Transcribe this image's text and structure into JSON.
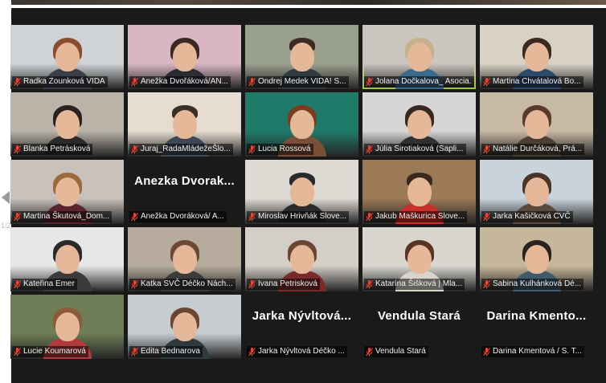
{
  "meeting": {
    "page_indicator": "1/2",
    "active_border_color": "#b7e34d",
    "muted_icon": "mic-muted-icon",
    "muted_color": "#e0483a"
  },
  "participants": [
    {
      "name": "Radka Zounková VIDA",
      "muted": true,
      "video": true,
      "bg": "#cfd3d6",
      "torso": "#3b3d48",
      "hair": "#8a4c2e",
      "type": "woman"
    },
    {
      "name": "Anežka Dvořáková/AN...",
      "muted": true,
      "video": true,
      "bg": "#d9b6c4",
      "torso": "#2c2c33",
      "hair": "#3a2a22",
      "type": "woman"
    },
    {
      "name": "Ondrej Medek VIDA! S...",
      "muted": true,
      "video": true,
      "bg": "#9aa08e",
      "torso": "#2f3b40",
      "hair": "#3b2b20",
      "type": "man"
    },
    {
      "name": "Jolana Dočkalova_ Asocia...",
      "muted": true,
      "video": true,
      "active": true,
      "bg": "#cbc6bf",
      "torso": "#3a6b8a",
      "hair": "#c4b18d",
      "type": "woman"
    },
    {
      "name": "Martina Chvátalová Bo...",
      "muted": true,
      "video": true,
      "bg": "#d8d2c5",
      "torso": "#2b4a6b",
      "hair": "#3a2a22",
      "type": "woman"
    },
    {
      "name": "Blanka Petrásková",
      "muted": true,
      "video": true,
      "bg": "#b9b3a8",
      "torso": "#2a2a2a",
      "hair": "#2b2220",
      "type": "woman"
    },
    {
      "name": "Juraj_RadaMládežeŠlo...",
      "muted": true,
      "video": true,
      "bg": "#e6ddd0",
      "torso": "#3f4655",
      "hair": "#3a2e25",
      "type": "man"
    },
    {
      "name": "Lucia Rossová",
      "muted": true,
      "video": true,
      "bg": "#1f7a6a",
      "torso": "#7a4f37",
      "hair": "#7a3c22",
      "type": "woman"
    },
    {
      "name": "Júlia Sirotiaková (Sapli...",
      "muted": true,
      "video": true,
      "bg": "#d6d6d6",
      "torso": "#303030",
      "hair": "#3a2820",
      "type": "woman"
    },
    {
      "name": "Natálie Durčáková, Prá...",
      "muted": true,
      "video": true,
      "bg": "#c8b9a4",
      "torso": "#4a3f35",
      "hair": "#5a3a2a",
      "type": "woman"
    },
    {
      "name": "Martina Škutová_Dom...",
      "muted": true,
      "video": true,
      "bg": "#c9c1bb",
      "torso": "#5a2430",
      "hair": "#9a6a3c",
      "type": "woman"
    },
    {
      "name": "Anežka Dvoráková/ A...",
      "muted": true,
      "video": false,
      "display": "Anezka Dvorak..."
    },
    {
      "name": "Miroslav Hrivňák Slove...",
      "muted": true,
      "video": true,
      "bg": "#dedad4",
      "torso": "#2b2b2b",
      "hair": "#2a2a2a",
      "type": "man"
    },
    {
      "name": "Jakub Maškurica Slove...",
      "muted": true,
      "video": true,
      "bg": "#9c7a58",
      "torso": "#c8302c",
      "hair": "#3a2a1e",
      "type": "man"
    },
    {
      "name": "Jarka Kašičková CVČ",
      "muted": true,
      "video": true,
      "bg": "#c9d3dc",
      "torso": "#5a4a3c",
      "hair": "#4a3428",
      "type": "woman"
    },
    {
      "name": "Kateřina Emer",
      "muted": true,
      "video": true,
      "bg": "#e7e7e7",
      "torso": "#3a3a3a",
      "hair": "#2a2a2a",
      "type": "woman"
    },
    {
      "name": "Katka SVČ Déčko Nách...",
      "muted": true,
      "video": true,
      "bg": "#b6ab9c",
      "torso": "#3b3b3b",
      "hair": "#6a4a35",
      "type": "woman"
    },
    {
      "name": "Ivana Petrisková",
      "muted": true,
      "video": true,
      "bg": "#d3cec6",
      "torso": "#7a2a2a",
      "hair": "#6a4632",
      "type": "woman"
    },
    {
      "name": "Katarína Šišková | Mla...",
      "muted": true,
      "video": true,
      "bg": "#d9d6d0",
      "torso": "#d8d4cc",
      "hair": "#5a3424",
      "type": "woman"
    },
    {
      "name": "Sabina Kulhánková Dé...",
      "muted": true,
      "video": true,
      "bg": "#c7b79a",
      "torso": "#3f5a6a",
      "hair": "#2a2220",
      "type": "woman"
    },
    {
      "name": "Lucie Koumarová",
      "muted": true,
      "video": true,
      "bg": "#6f7d56",
      "torso": "#b33a3a",
      "hair": "#8a5a3a",
      "type": "woman"
    },
    {
      "name": "Edita Bednarova",
      "muted": true,
      "video": true,
      "bg": "#c7ccd1",
      "torso": "#2f3a3f",
      "hair": "#6a4632",
      "type": "woman"
    },
    {
      "name": "Jarka Nývltová Déčko ...",
      "muted": true,
      "video": false,
      "display": "Jarka Nývltová..."
    },
    {
      "name": "Vendula Stará",
      "muted": true,
      "video": false,
      "display": "Vendula Stará"
    },
    {
      "name": "Darina Kmentová / S. T...",
      "muted": true,
      "video": false,
      "display": "Darina Kmento..."
    }
  ]
}
